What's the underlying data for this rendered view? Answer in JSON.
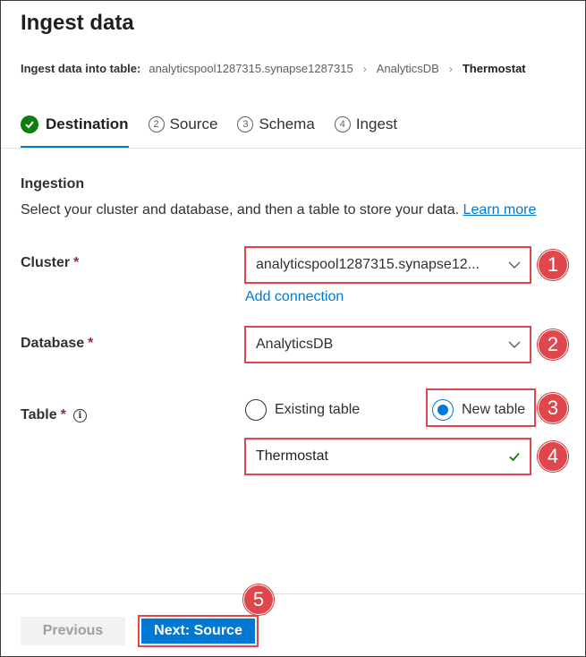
{
  "header": {
    "title": "Ingest data",
    "breadcrumb_label": "Ingest data into table:",
    "breadcrumb": [
      "analyticspool1287315.synapse1287315",
      "AnalyticsDB",
      "Thermostat"
    ]
  },
  "tabs": [
    {
      "label": "Destination",
      "status": "complete",
      "active": true
    },
    {
      "label": "Source",
      "number": "2",
      "active": false
    },
    {
      "label": "Schema",
      "number": "3",
      "active": false
    },
    {
      "label": "Ingest",
      "number": "4",
      "active": false
    }
  ],
  "section": {
    "title": "Ingestion",
    "description": "Select your cluster and database, and then a table to store your data.",
    "learn_more": "Learn more"
  },
  "form": {
    "cluster_label": "Cluster",
    "cluster_value": "analyticspool1287315.synapse12...",
    "add_connection": "Add connection",
    "database_label": "Database",
    "database_value": "AnalyticsDB",
    "table_label": "Table",
    "required_marker": "*",
    "info_icon": "i",
    "existing_table": "Existing table",
    "new_table": "New table",
    "selected_table_option": "New table",
    "table_name_value": "Thermostat"
  },
  "callouts": [
    "1",
    "2",
    "3",
    "4",
    "5"
  ],
  "footer": {
    "previous_label": "Previous",
    "next_label": "Next: Source"
  },
  "colors": {
    "accent": "#0078d4",
    "success": "#107c10",
    "highlight": "#e0474c",
    "required": "#a4262c"
  }
}
